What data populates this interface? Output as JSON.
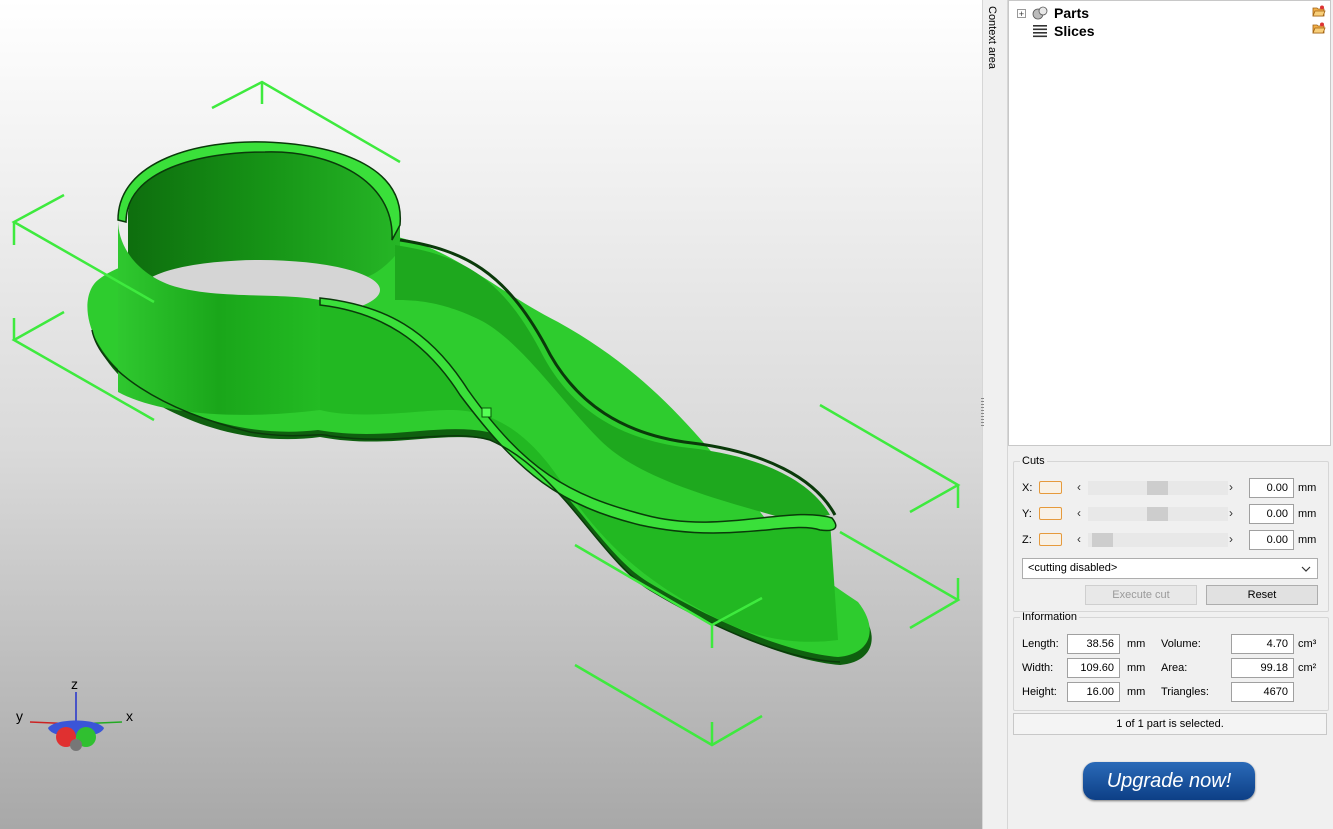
{
  "context_label": "Context area",
  "tree": {
    "items": [
      {
        "label": "Parts",
        "icon": "parts-icon",
        "expander": "+"
      },
      {
        "label": "Slices",
        "icon": "slices-icon"
      }
    ]
  },
  "axes_gizmo": {
    "x": "x",
    "y": "y",
    "z": "z"
  },
  "cuts": {
    "title": "Cuts",
    "rows": [
      {
        "label": "X:",
        "value": "0.00",
        "unit": "mm"
      },
      {
        "label": "Y:",
        "value": "0.00",
        "unit": "mm"
      },
      {
        "label": "Z:",
        "value": "0.00",
        "unit": "mm"
      }
    ],
    "mode": "<cutting disabled>",
    "execute_label": "Execute cut",
    "reset_label": "Reset"
  },
  "information": {
    "title": "Information",
    "length_label": "Length:",
    "length_value": "38.56",
    "length_unit": "mm",
    "width_label": "Width:",
    "width_value": "109.60",
    "width_unit": "mm",
    "height_label": "Height:",
    "height_value": "16.00",
    "height_unit": "mm",
    "volume_label": "Volume:",
    "volume_value": "4.70",
    "volume_unit": "cm³",
    "area_label": "Area:",
    "area_value": "99.18",
    "area_unit": "cm²",
    "triangles_label": "Triangles:",
    "triangles_value": "4670"
  },
  "status": "1 of 1 part is selected.",
  "upgrade_label": "Upgrade now!",
  "colors": {
    "model": "#22cc22",
    "bbox": "#33ee33",
    "accent": "#e69a3c",
    "upgrade": "#124a96"
  }
}
